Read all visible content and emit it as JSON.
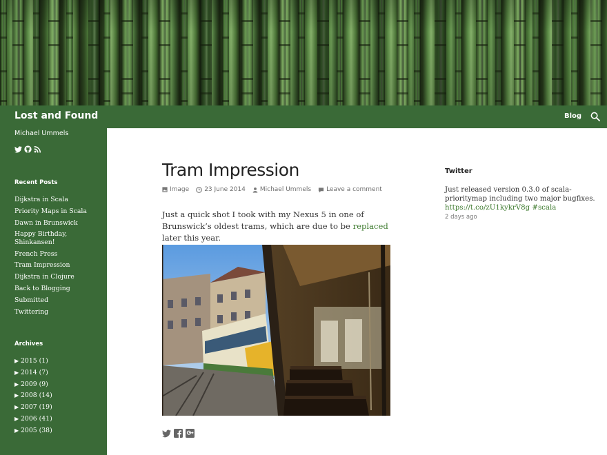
{
  "site": {
    "title": "Lost and Found",
    "author": "Michael Ummels"
  },
  "nav": {
    "blog_label": "Blog"
  },
  "sidebar": {
    "recent_title": "Recent Posts",
    "recent_posts": [
      "Dijkstra in Scala",
      "Priority Maps in Scala",
      "Dawn in Brunswick",
      "Happy Birthday, Shinkansen!",
      "French Press",
      "Tram Impression",
      "Dijkstra in Clojure",
      "Back to Blogging",
      "Submitted",
      "Twittering"
    ],
    "archives_title": "Archives",
    "archives": [
      {
        "year": "2015",
        "count": "(1)"
      },
      {
        "year": "2014",
        "count": "(7)"
      },
      {
        "year": "2009",
        "count": "(9)"
      },
      {
        "year": "2008",
        "count": "(14)"
      },
      {
        "year": "2007",
        "count": "(19)"
      },
      {
        "year": "2006",
        "count": "(41)"
      },
      {
        "year": "2005",
        "count": "(38)"
      }
    ]
  },
  "post": {
    "title": "Tram Impression",
    "format": "Image",
    "date": "23 June 2014",
    "author": "Michael Ummels",
    "comments": "Leave a comment",
    "body_before": "Just a quick shot I took with my Nexus 5 in one of Brunswick’s oldest trams, which are due to be ",
    "body_link": "replaced",
    "body_after": " later this year."
  },
  "twitter": {
    "title": "Twitter",
    "tweet_text": "Just released version 0.3.0 of scala-priority­map including two major bugfixes.",
    "tweet_link": "https://t.co/zU1kykrV8g",
    "tweet_tag": "#scala",
    "time": "2 days ago"
  },
  "colors": {
    "brand_green": "#3a6a37",
    "link_green": "#3d7a2e"
  }
}
